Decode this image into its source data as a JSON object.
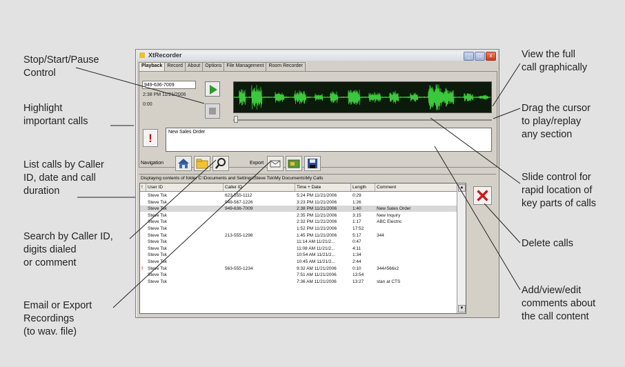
{
  "annotations": {
    "stop_start_pause": "Stop/Start/Pause\nControl",
    "highlight": "Highlight\nimportant calls",
    "list_calls": "List calls by Caller\nID, date and call\nduration",
    "search": "Search by Caller ID,\ndigits dialed\nor comment",
    "email_export": "Email or Export\nRecordings\n(to wav. file)",
    "view_full": "View the full\ncall graphically",
    "drag_cursor": "Drag the cursor\nto play/replay\nany section",
    "slide_control": "Slide control for\nrapid location of\nkey parts of calls",
    "delete": "Delete calls",
    "comments": "Add/view/edit\ncomments about\nthe call content"
  },
  "window": {
    "title": "XtRecorder",
    "tabs": [
      "Playback",
      "Record",
      "About",
      "Options",
      "File Management",
      "Room Recorder"
    ],
    "active_tab": "Playback"
  },
  "playback": {
    "phone": "949-636-7009",
    "datetime": "2:38 PM 11/21/2006",
    "elapsed": "0:00",
    "comment": "New Sales Order",
    "important_glyph": "!"
  },
  "toolbar": {
    "navigation_label": "Navigation",
    "export_label": "Export"
  },
  "list": {
    "folder_text": "Displaying contents of folder C:\\Documents and Settings\\Steve Tsk\\My Documents\\My Calls",
    "columns": [
      "!",
      "User ID",
      "Caller ID",
      "Time + Date",
      "Length",
      "Comment"
    ],
    "rows": [
      {
        "flag": "",
        "user": "Steve Tsk",
        "caller": "623-555-1112",
        "time": "5:24 PM 11/21/2006",
        "length": "0:29",
        "comment": ""
      },
      {
        "flag": "",
        "user": "Steve Tsk",
        "caller": "949-567-1226",
        "time": "3:23 PM 11/21/2006",
        "length": "1:26",
        "comment": ""
      },
      {
        "flag": "",
        "user": "Steve Tsk",
        "caller": "949-636-7009",
        "time": "2:38 PM 11/21/2006",
        "length": "1:40",
        "comment": "New Sales Order",
        "selected": true
      },
      {
        "flag": "",
        "user": "Steve Tsk",
        "caller": "",
        "time": "2:35 PM 11/21/2006",
        "length": "3:15",
        "comment": "New Inquiry"
      },
      {
        "flag": "",
        "user": "Steve Tsk",
        "caller": "",
        "time": "2:32 PM 11/21/2006",
        "length": "1:17",
        "comment": "ABC Electric"
      },
      {
        "flag": "",
        "user": "Steve Tsk",
        "caller": "",
        "time": "1:52 PM 11/21/2006",
        "length": "17:52",
        "comment": ""
      },
      {
        "flag": "",
        "user": "Steve Tsk",
        "caller": "213-555-1298",
        "time": "1:45 PM 11/21/2006",
        "length": "5:17",
        "comment": "344"
      },
      {
        "flag": "",
        "user": "Steve Tsk",
        "caller": "",
        "time": "11:14 AM 11/21/2...",
        "length": "0:47",
        "comment": ""
      },
      {
        "flag": "",
        "user": "Steve Tsk",
        "caller": "",
        "time": "11:08 AM 11/21/2...",
        "length": "4:11",
        "comment": ""
      },
      {
        "flag": "",
        "user": "Steve Tsk",
        "caller": "",
        "time": "10:54 AM 11/21/2...",
        "length": "1:34",
        "comment": ""
      },
      {
        "flag": "",
        "user": "Steve Tsk",
        "caller": "",
        "time": "10:45 AM 11/21/2...",
        "length": "2:44",
        "comment": ""
      },
      {
        "flag": "!",
        "user": "Steve Tsk",
        "caller": "563-555-1234",
        "time": "9:32 AM 11/21/2006",
        "length": "0:10",
        "comment": "344#566x2"
      },
      {
        "flag": "",
        "user": "Steve Tsk",
        "caller": "",
        "time": "7:51 AM 11/21/2006",
        "length": "13:54",
        "comment": ""
      },
      {
        "flag": "",
        "user": "Steve Tsk",
        "caller": "",
        "time": "7:36 AM 11/21/2006",
        "length": "13:27",
        "comment": "stan at CTS"
      }
    ]
  },
  "colors": {
    "background": "#e2e2e2",
    "waveform": "#3cc83c",
    "delete": "#d01818",
    "important": "#c01010"
  }
}
